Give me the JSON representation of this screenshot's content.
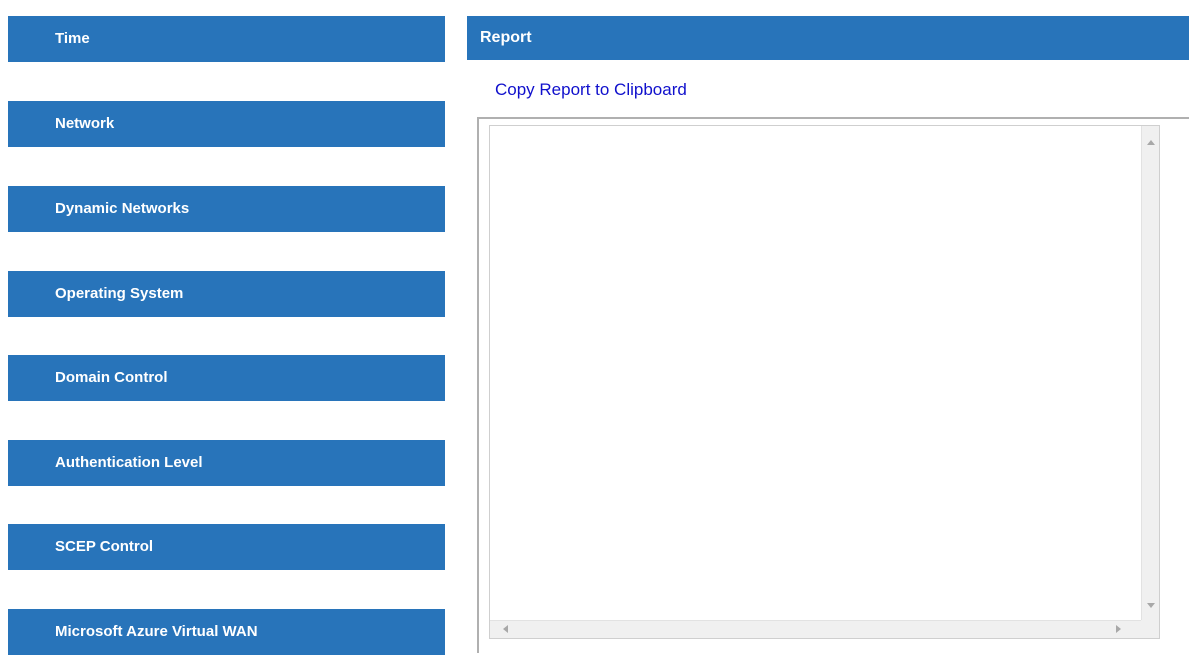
{
  "sidebar": {
    "items": [
      {
        "label": "Time"
      },
      {
        "label": "Network"
      },
      {
        "label": "Dynamic Networks"
      },
      {
        "label": "Operating System"
      },
      {
        "label": "Domain Control"
      },
      {
        "label": "Authentication Level"
      },
      {
        "label": "SCEP Control"
      },
      {
        "label": "Microsoft Azure Virtual WAN"
      }
    ]
  },
  "report": {
    "title": "Report",
    "copy_link": "Copy Report to Clipboard",
    "content": ""
  },
  "colors": {
    "accent": "#2874ba",
    "link": "#1010cc",
    "scrollbar": "#f0f0f0"
  },
  "icons": [
    "scroll-up-arrow-icon",
    "scroll-down-arrow-icon",
    "scroll-left-arrow-icon",
    "scroll-right-arrow-icon"
  ]
}
